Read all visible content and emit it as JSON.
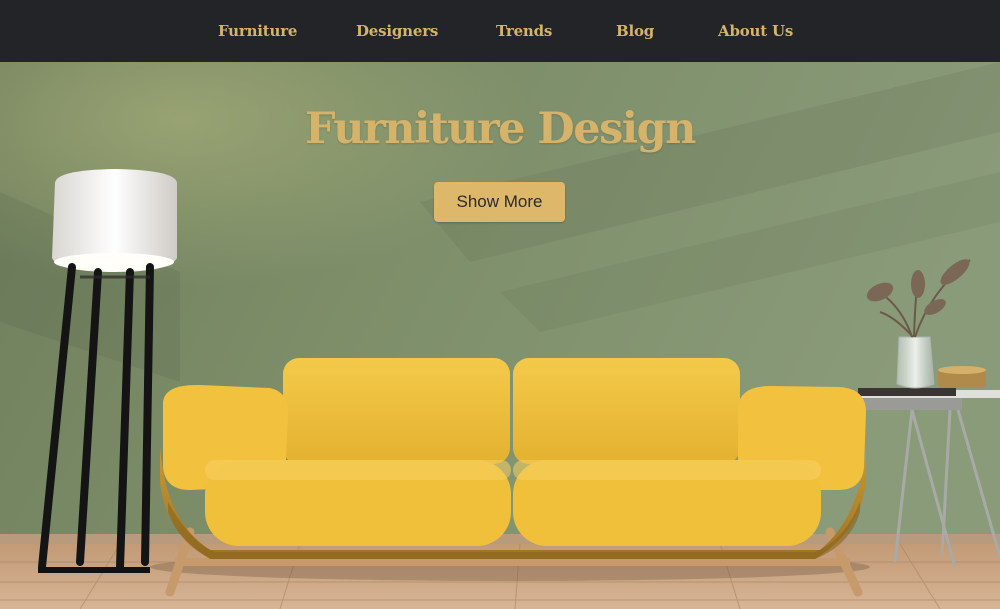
{
  "nav": {
    "items": [
      {
        "label": "Furniture"
      },
      {
        "label": "Designers"
      },
      {
        "label": "Trends"
      },
      {
        "label": "Blog"
      },
      {
        "label": "About Us"
      }
    ]
  },
  "hero": {
    "title": "Furniture Design",
    "button_label": "Show More"
  },
  "colors": {
    "navbar_bg": "#222428",
    "accent_gold": "#d4b46a",
    "wall_green": "#7e8f6a",
    "sofa_yellow": "#f0c13e",
    "floor_wood": "#c9a481"
  }
}
